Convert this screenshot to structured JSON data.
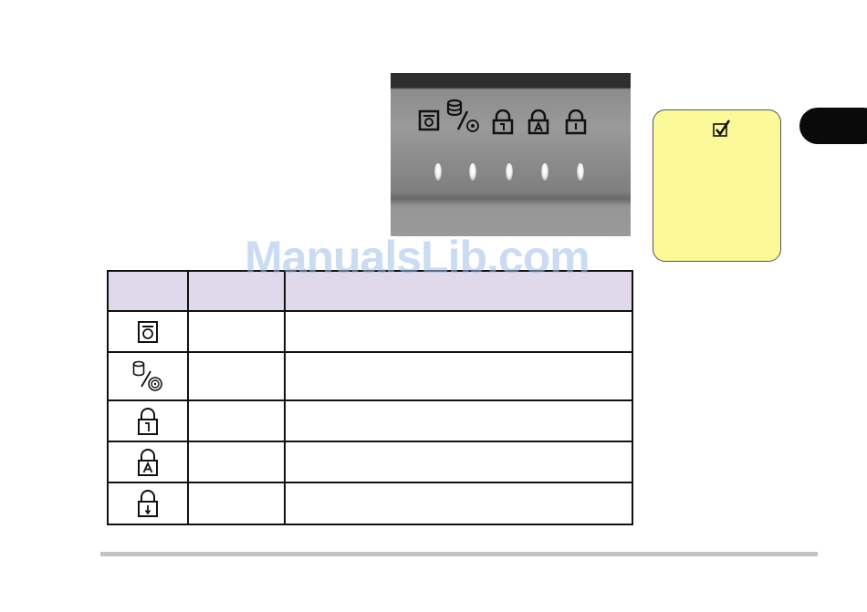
{
  "watermark": "ManualsLib.com",
  "panel": {
    "icons": [
      "power-status-icon",
      "hdd-cdrom-access-icon",
      "num-lock-icon",
      "caps-lock-icon",
      "scroll-lock-icon"
    ],
    "leds_lit": 5
  },
  "note": {
    "icon": "checkmark-note-icon",
    "background": "#fcf99a"
  },
  "table": {
    "header_background": "#e0d9ec",
    "columns": [
      "",
      "",
      ""
    ],
    "rows": [
      {
        "icon": "power-status-icon",
        "name": "",
        "description": ""
      },
      {
        "icon": "hdd-cdrom-access-icon",
        "name": "",
        "description": ""
      },
      {
        "icon": "num-lock-icon",
        "name": "",
        "description": ""
      },
      {
        "icon": "caps-lock-icon",
        "name": "",
        "description": ""
      },
      {
        "icon": "scroll-lock-icon",
        "name": "",
        "description": ""
      }
    ]
  }
}
